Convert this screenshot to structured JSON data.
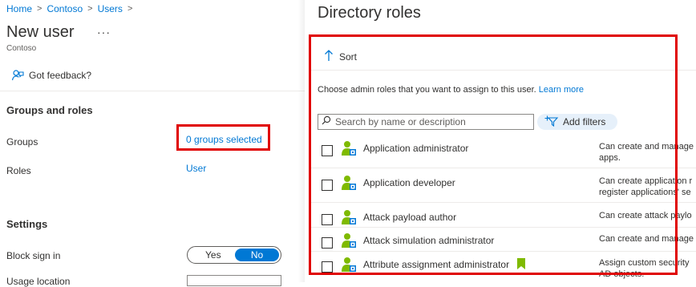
{
  "breadcrumb": [
    "Home",
    "Contoso",
    "Users"
  ],
  "page": {
    "title": "New user",
    "more": "···",
    "subtitle": "Contoso",
    "feedback": "Got feedback?"
  },
  "groups_and_roles": {
    "heading": "Groups and roles",
    "groups_label": "Groups",
    "groups_value": "0 groups selected",
    "roles_label": "Roles",
    "roles_value": "User"
  },
  "settings": {
    "heading": "Settings",
    "block_label": "Block sign in",
    "toggle_yes": "Yes",
    "toggle_no": "No",
    "toggle_selected": "No",
    "next_label": "Usage location"
  },
  "panel": {
    "title": "Directory roles",
    "sort": "Sort",
    "instruction": "Choose admin roles that you want to assign to this user.",
    "learn_more": "Learn more",
    "search_placeholder": "Search by name or description",
    "add_filters": "Add filters",
    "roles": [
      {
        "name": "Application administrator",
        "desc": [
          "Can create and manage",
          "apps."
        ],
        "bookmark": false
      },
      {
        "name": "Application developer",
        "desc": [
          "Can create application r",
          "register applications' se"
        ],
        "bookmark": false
      },
      {
        "name": "Attack payload author",
        "desc": [
          "Can create attack paylo"
        ],
        "bookmark": false
      },
      {
        "name": "Attack simulation administrator",
        "desc": [
          "Can create and manage"
        ],
        "bookmark": false
      },
      {
        "name": "Attribute assignment administrator",
        "desc": [
          "Assign custom security",
          "AD objects."
        ],
        "bookmark": true
      }
    ]
  },
  "colors": {
    "accent": "#0078d4",
    "highlight": "#e00000",
    "filter_bg": "#e6f0fa",
    "role_icon_green": "#7fba00",
    "bookmark_green": "#7fba00"
  },
  "icons": {
    "feedback": "feedback-person-icon",
    "sort": "arrow-up-icon",
    "search": "search-icon",
    "filter": "add-filter-icon",
    "role": "role-person-icon",
    "bookmark": "bookmark-icon"
  }
}
